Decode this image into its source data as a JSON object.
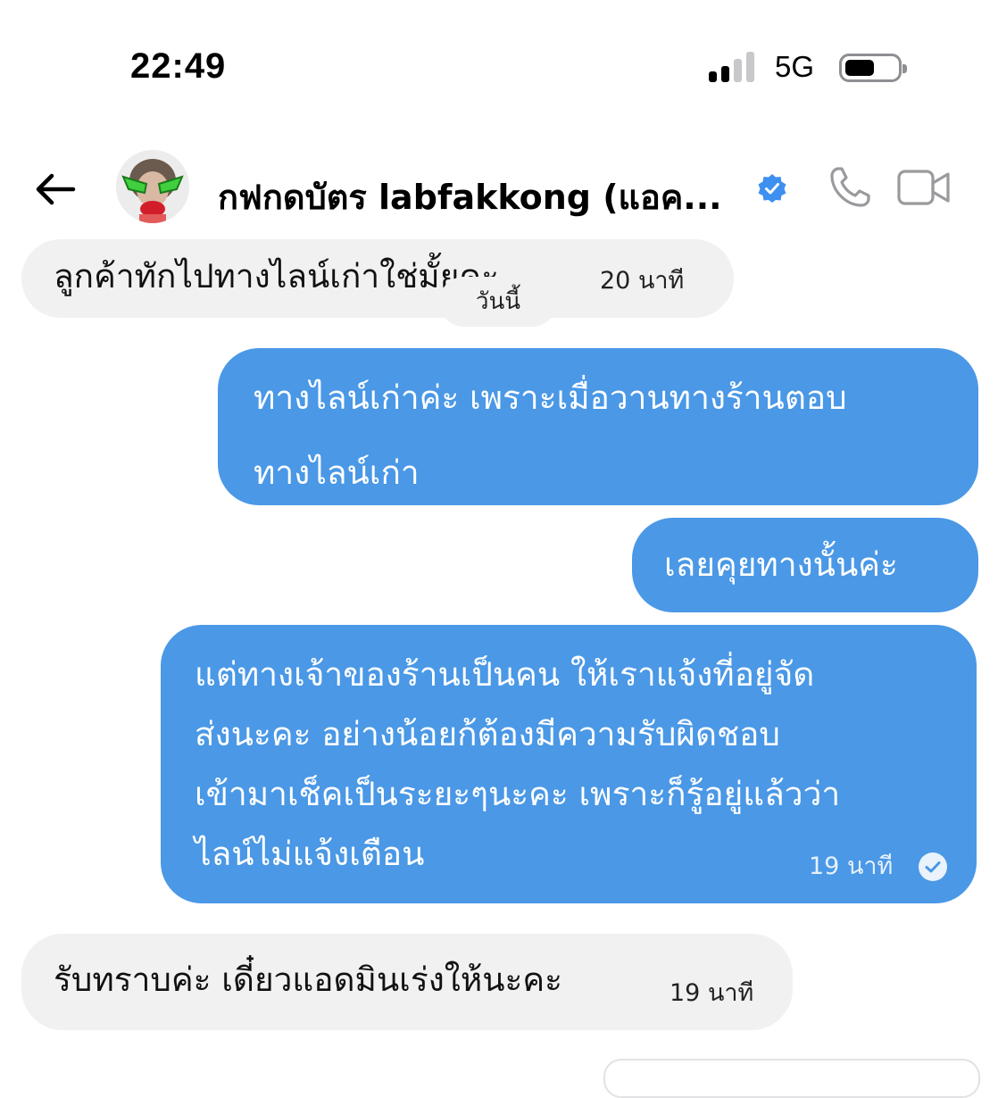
{
  "status_bar": {
    "time": "22:49",
    "network": "5G",
    "battery_level": 0.55
  },
  "header": {
    "contact_name": "กฟกดบัตร labfakkong (แอค...",
    "verified_icon": "verified-badge-icon",
    "call_icon": "phone-icon",
    "video_icon": "video-camera-icon",
    "back_icon": "back-arrow-icon"
  },
  "colors": {
    "outgoing_bubble": "#4a98e6",
    "incoming_bubble": "#f1f1f2",
    "verified": "#3d8ff0"
  },
  "date_separator": "วันนี้",
  "messages": [
    {
      "direction": "in",
      "text": "ลูกค้าทักไปทางไลน์เก่าใช่มั้ยคะ",
      "time": "20 นาที"
    },
    {
      "direction": "out",
      "lines": [
        "ทางไลน์เก่าค่ะ เพราะเมื่อวานทางร้านตอบ",
        "ทางไลน์เก่า"
      ]
    },
    {
      "direction": "out",
      "text": "เลยคุยทางนั้นค่ะ"
    },
    {
      "direction": "out",
      "lines": [
        "แต่ทางเจ้าของร้านเป็นคน ให้เราแจ้งที่อยู่จัด",
        "ส่งนะคะ อย่างน้อยก้ต้องมีความรับผิดชอบ",
        "เข้ามาเช็คเป็นระยะๆนะคะ เพราะก็รู้อยู่แล้วว่า",
        "ไลน์ไม่แจ้งเตือน"
      ],
      "time": "19 นาที",
      "status": "read-check-icon"
    },
    {
      "direction": "in",
      "text": "รับทราบค่ะ เดี๋ยวแอดมินเร่งให้นะคะ",
      "time": "19 นาที"
    }
  ]
}
